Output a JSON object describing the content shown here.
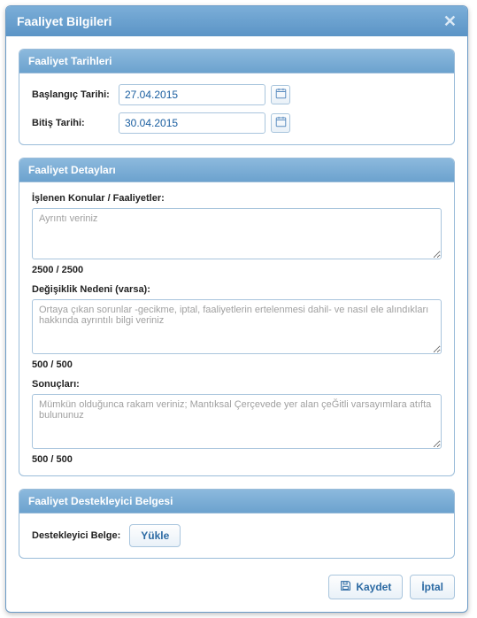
{
  "dialog": {
    "title": "Faaliyet Bilgileri"
  },
  "sections": {
    "dates": {
      "title": "Faaliyet Tarihleri",
      "start_label": "Başlangıç Tarihi:",
      "start_value": "27.04.2015",
      "end_label": "Bitiş Tarihi:",
      "end_value": "30.04.2015"
    },
    "details": {
      "title": "Faaliyet Detayları",
      "topics_label": "İşlenen Konular / Faaliyetler:",
      "topics_placeholder": "Ayrıntı veriniz",
      "topics_counter": "2500 / 2500",
      "change_label": "Değişiklik Nedeni (varsa):",
      "change_placeholder": "Ortaya çıkan sorunlar -gecikme, iptal, faaliyetlerin ertelenmesi dahil- ve nasıl ele alındıkları hakkında ayrıntılı bilgi veriniz",
      "change_counter": "500 / 500",
      "results_label": "Sonuçları:",
      "results_placeholder": "Mümkün olduğunca rakam veriniz; Mantıksal Çerçevede yer alan çeĞitli varsayımlara atıfta bulununuz",
      "results_counter": "500 / 500"
    },
    "docs": {
      "title": "Faaliyet Destekleyici Belgesi",
      "label": "Destekleyici Belge:",
      "upload_btn": "Yükle"
    }
  },
  "footer": {
    "save": "Kaydet",
    "cancel": "İptal"
  }
}
